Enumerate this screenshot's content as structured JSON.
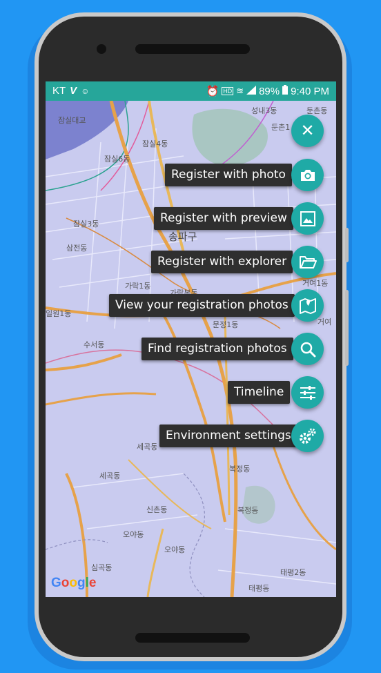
{
  "status_bar": {
    "carrier": "KT",
    "battery": "89%",
    "time": "9:40 PM"
  },
  "map": {
    "labels": {
      "jamsil_bridge": "잠실대교",
      "jamsil4": "잠실4동",
      "jamsil6": "잠실6동",
      "jamsil3": "잠실3동",
      "samjeon": "삼전동",
      "songpa": "송파구",
      "garak1": "가락1동",
      "garakbon": "가락본동",
      "sinseong": "성내3동",
      "dunchon": "둔촌동",
      "dunchon_road": "둔촌1",
      "munjeong": "문정1동",
      "suseo": "수서동",
      "ilwon": "일원1동",
      "segok": "세곡동",
      "segok2": "세곡동",
      "bokjeong": "복정동",
      "bokjeong2": "복정동",
      "sinchon": "신촌동",
      "oya": "오야동",
      "simgok": "심곡동",
      "taepyeong2": "태평2동",
      "taepyeong": "태평동",
      "geoyeo1": "거여1동",
      "geoyeo": "거여"
    },
    "attribution": "Google"
  },
  "fab_menu": {
    "close_button": "close",
    "items": [
      {
        "label": "Register with photo",
        "icon": "camera-icon"
      },
      {
        "label": "Register with preview",
        "icon": "image-icon"
      },
      {
        "label": "Register with explorer",
        "icon": "folder-open-icon"
      },
      {
        "label": "View your registration photos",
        "icon": "map-pin-icon"
      },
      {
        "label": "Find registration photos",
        "icon": "search-icon"
      },
      {
        "label": "Timeline",
        "icon": "sliders-icon"
      },
      {
        "label": "Environment settings",
        "icon": "gears-icon"
      }
    ]
  },
  "colors": {
    "background": "#2196F3",
    "status_bar": "#26a69a",
    "fab": "#1faaa6",
    "label_bg": "#2f2f2f",
    "map_tint": "#c7c9ee"
  }
}
